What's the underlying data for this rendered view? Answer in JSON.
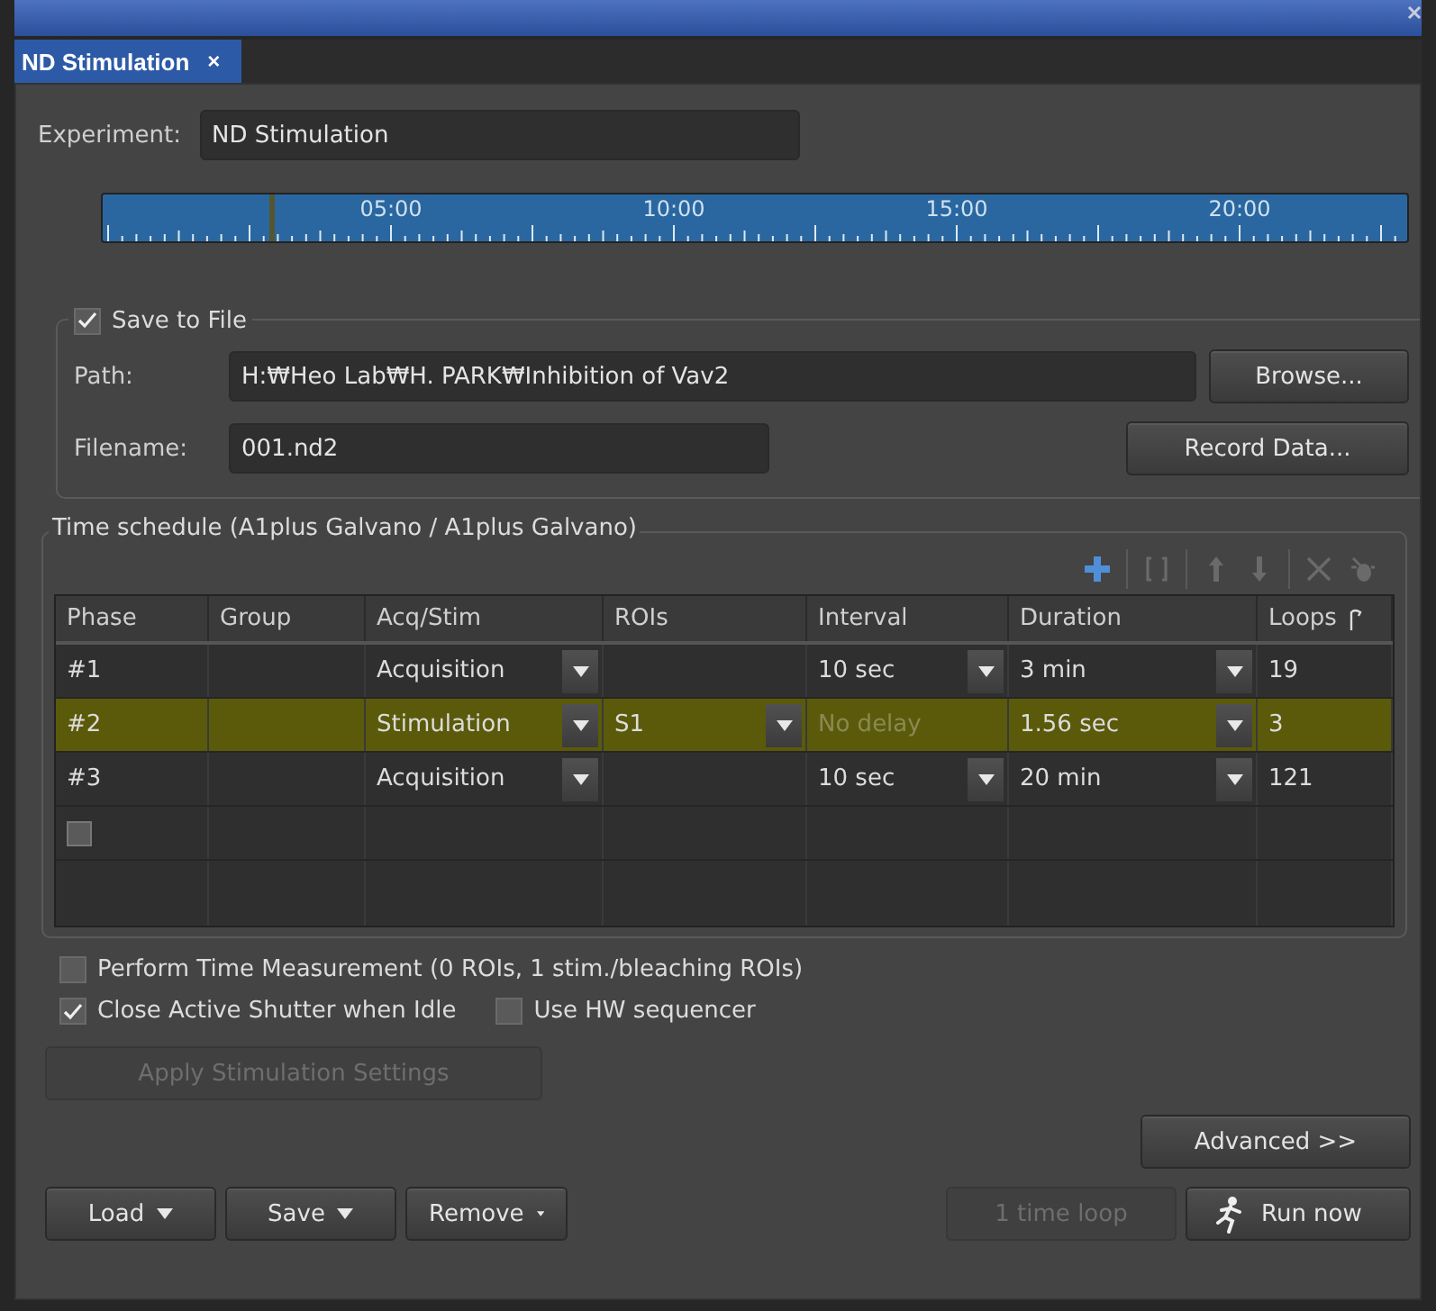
{
  "tabs": [
    {
      "label": "ND Stimulation",
      "close": "×",
      "selected": true
    }
  ],
  "experiment": {
    "label": "Experiment:",
    "value": "ND Stimulation"
  },
  "timeline": {
    "labels": [
      "05:00",
      "10:00",
      "15:00",
      "20:00"
    ],
    "marker": {
      "level": 0.13
    }
  },
  "save_to_file": {
    "label": "Save to File",
    "checked": true,
    "path_label": "Path:",
    "path": "H:₩Heo Lab₩H. PARK₩Inhibition of Vav2",
    "browse": "Browse...",
    "filename_label": "Filename:",
    "filename": "001.nd2",
    "record": "Record Data..."
  },
  "schedule": {
    "title": "Time schedule (A1plus Galvano / A1plus Galvano)",
    "toolbar": [
      {
        "kind": "add",
        "disabled": false
      },
      {
        "kind": "group",
        "disabled": true
      },
      {
        "kind": "up",
        "disabled": true
      },
      {
        "kind": "down",
        "disabled": true
      },
      {
        "kind": "delete",
        "disabled": true
      },
      {
        "kind": "bug",
        "disabled": true
      }
    ],
    "columns": [
      "Phase",
      "Group",
      "Acq/Stim",
      "ROIs",
      "Interval",
      "Duration",
      "Loops"
    ],
    "rows": [
      {
        "selected": false,
        "cells": [
          {
            "text": "#1",
            "dropdown": false,
            "disabled": false
          },
          null,
          {
            "text": "Acquisition",
            "dropdown": true,
            "disabled": false
          },
          null,
          {
            "text": "10 sec",
            "dropdown": true,
            "disabled": false
          },
          {
            "text": "3 min",
            "dropdown": true,
            "disabled": false
          },
          {
            "text": "19",
            "dropdown": false,
            "disabled": false
          }
        ]
      },
      {
        "selected": true,
        "cells": [
          {
            "text": "#2",
            "dropdown": false,
            "disabled": false
          },
          null,
          {
            "text": "Stimulation",
            "dropdown": true,
            "disabled": false
          },
          {
            "text": "S1",
            "dropdown": true,
            "disabled": false
          },
          {
            "text": "No delay",
            "dropdown": false,
            "disabled": true
          },
          {
            "text": "1.56 sec",
            "dropdown": true,
            "disabled": false
          },
          {
            "text": "3",
            "dropdown": false,
            "disabled": false
          }
        ]
      },
      {
        "selected": false,
        "cells": [
          {
            "text": "#3",
            "dropdown": false,
            "disabled": false
          },
          null,
          {
            "text": "Acquisition",
            "dropdown": true,
            "disabled": false
          },
          null,
          {
            "text": "10 sec",
            "dropdown": true,
            "disabled": false
          },
          {
            "text": "20 min",
            "dropdown": true,
            "disabled": false
          },
          {
            "text": "121",
            "dropdown": false,
            "disabled": false
          }
        ]
      }
    ],
    "new_row": {
      "checked": false
    }
  },
  "options": [
    {
      "label": "Perform Time Measurement (0 ROIs, 1 stim./bleaching ROIs)",
      "checked": false
    },
    {
      "label": "Close Active Shutter when Idle",
      "checked": true
    },
    {
      "label": "Use HW sequencer",
      "checked": false
    }
  ],
  "apply_button": {
    "label": "Apply Stimulation Settings",
    "disabled": true
  },
  "advanced_button": {
    "label": "Advanced >>"
  },
  "bottom_buttons": [
    {
      "label": "Load",
      "dropdown": true
    },
    {
      "label": "Save",
      "dropdown": true
    },
    {
      "label": "Remove",
      "dropdown": true
    }
  ],
  "loop_button": {
    "label": "1 time loop",
    "disabled": true
  },
  "run_button": {
    "label": "Run now"
  }
}
